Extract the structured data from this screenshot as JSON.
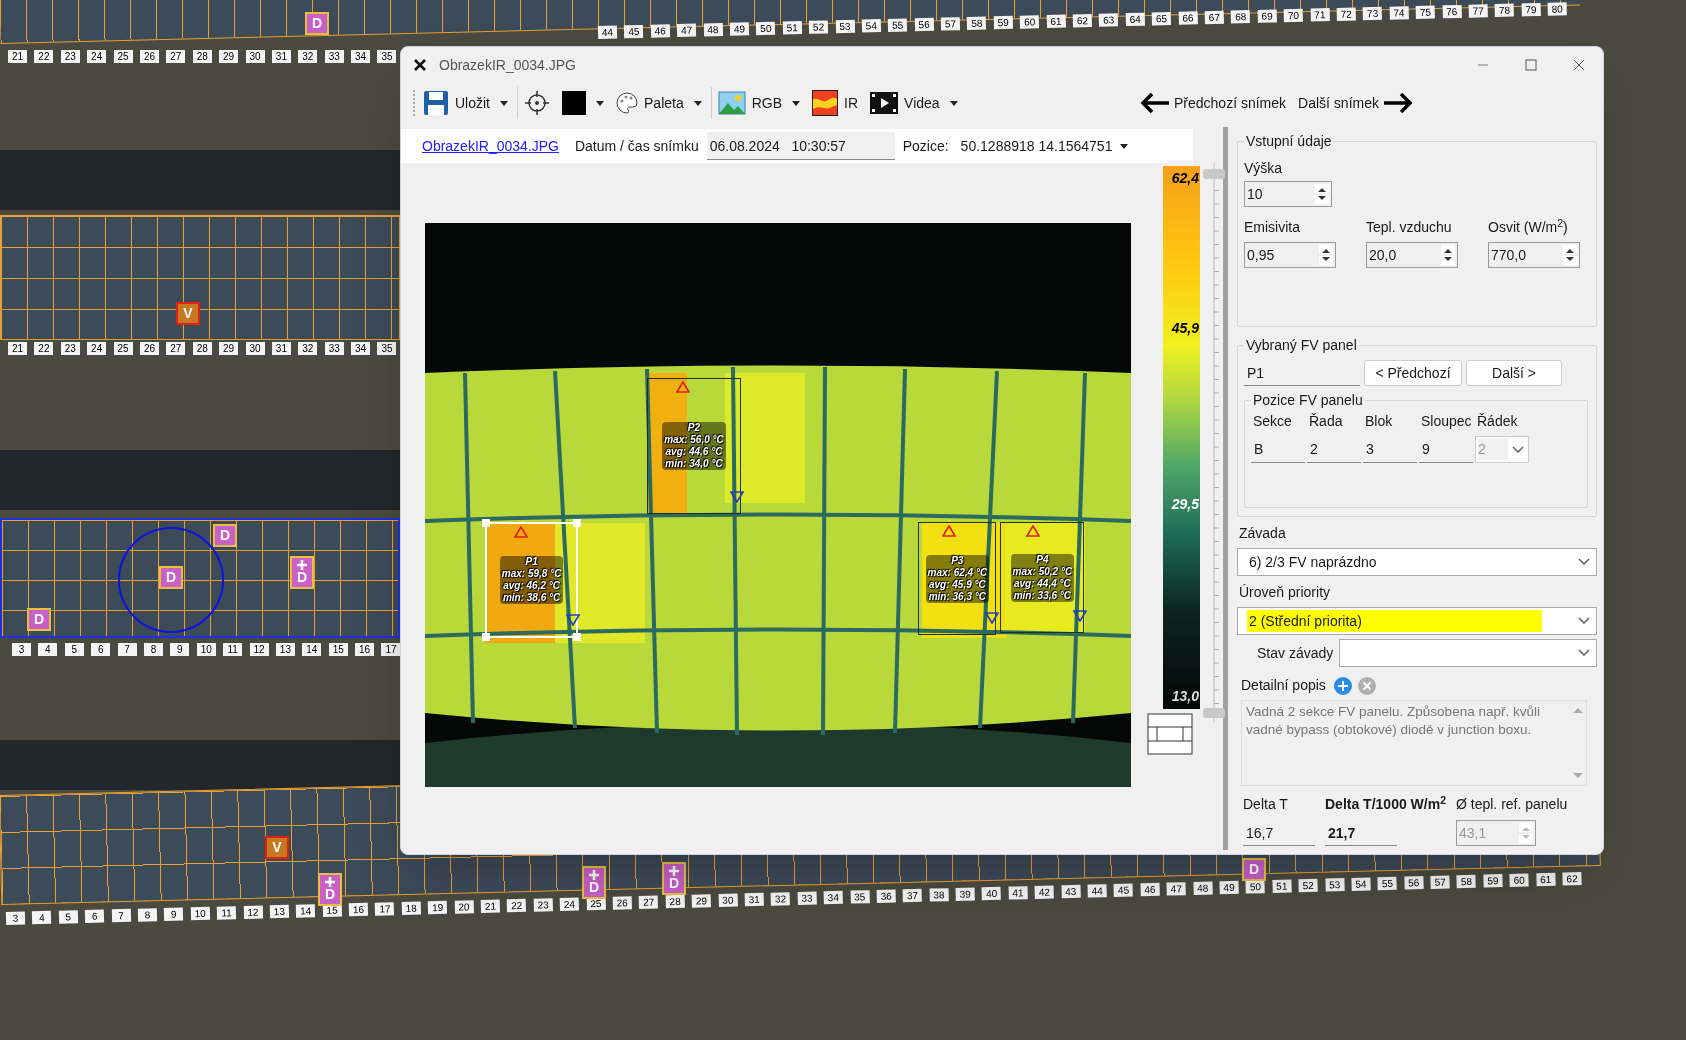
{
  "map": {
    "number_rows": [
      {
        "labels": [
          "21",
          "22",
          "23",
          "24",
          "25",
          "26",
          "27",
          "28",
          "29",
          "30",
          "31",
          "32",
          "33",
          "34",
          "35"
        ]
      },
      {
        "labels": [
          "44",
          "45",
          "46",
          "47",
          "48",
          "49",
          "50",
          "51",
          "52",
          "53",
          "54",
          "55",
          "56",
          "57",
          "58",
          "59",
          "60",
          "61",
          "62",
          "63",
          "64",
          "65",
          "66",
          "67",
          "68",
          "69",
          "70",
          "71",
          "72",
          "73",
          "74",
          "75",
          "76",
          "77",
          "78",
          "79",
          "80"
        ]
      },
      {
        "labels": [
          "21",
          "22",
          "23",
          "24",
          "25",
          "26",
          "27",
          "28",
          "29",
          "30",
          "31",
          "32",
          "33",
          "34",
          "35"
        ]
      },
      {
        "labels": [
          "3",
          "4",
          "5",
          "6",
          "7",
          "8",
          "9",
          "10",
          "11",
          "12",
          "13",
          "14",
          "15",
          "16",
          "17"
        ]
      },
      {
        "labels": [
          "3",
          "4",
          "5",
          "6",
          "7",
          "8",
          "9",
          "10",
          "11",
          "12",
          "13",
          "14",
          "15",
          "16",
          "17",
          "18",
          "19",
          "20",
          "21",
          "22",
          "23",
          "24",
          "25",
          "26",
          "27",
          "28",
          "29",
          "30",
          "31",
          "32",
          "33",
          "34",
          "35",
          "36",
          "37",
          "38",
          "39",
          "40",
          "41",
          "42",
          "43",
          "44",
          "45",
          "46",
          "47",
          "48",
          "49",
          "50",
          "51",
          "52",
          "53",
          "54",
          "55",
          "56",
          "57",
          "58",
          "59",
          "60",
          "61",
          "62"
        ]
      }
    ],
    "markers": [
      {
        "label": "D",
        "kind": "d",
        "plus": false
      },
      {
        "label": "V",
        "kind": "v",
        "plus": false
      },
      {
        "label": "D",
        "kind": "d",
        "plus": false
      },
      {
        "label": "D",
        "kind": "d",
        "plus": false
      },
      {
        "label": "D",
        "kind": "d",
        "plus": true
      },
      {
        "label": "D",
        "kind": "d",
        "plus": false
      },
      {
        "label": "V",
        "kind": "v",
        "plus": false
      },
      {
        "label": "D",
        "kind": "d",
        "plus": true
      },
      {
        "label": "D",
        "kind": "d",
        "plus": true
      },
      {
        "label": "D",
        "kind": "d",
        "plus": true
      },
      {
        "label": "D",
        "kind": "d",
        "plus": false
      }
    ]
  },
  "window": {
    "title": "ObrazekIR_0034.JPG"
  },
  "toolbar": {
    "items": [
      {
        "kind": "save",
        "label": "Uložit",
        "dropdown": true
      },
      {
        "kind": "target",
        "dropdown": false
      },
      {
        "kind": "color",
        "dropdown": true
      },
      {
        "kind": "palette",
        "label": "Paleta",
        "dropdown": true
      },
      {
        "kind": "rgb",
        "label": "RGB",
        "dropdown": true
      },
      {
        "kind": "ir",
        "label": "IR",
        "dropdown": false
      },
      {
        "kind": "video",
        "label": "Videa",
        "dropdown": true
      }
    ],
    "prev": "Předchozí snímek",
    "next": "Další snímek"
  },
  "info": {
    "file_link": "ObrazekIR_0034.JPG",
    "datetime_label": "Datum / čas snímku",
    "datetime_value": "06.08.2024   10:30:57",
    "position_label": "Pozice:",
    "position_value": "50.1288918 14.1564751"
  },
  "scale_labels": [
    "62,4",
    "45,9",
    "29,5",
    "13,0"
  ],
  "annotations": [
    {
      "name": "P1",
      "lines": [
        "max: 59,8 °C",
        "avg: 46,2 °C",
        "min: 38,6 °C"
      ],
      "selected": true
    },
    {
      "name": "P2",
      "lines": [
        "max: 56,0 °C",
        "avg: 44,6 °C",
        "min: 34,0 °C"
      ],
      "selected": false
    },
    {
      "name": "P3",
      "lines": [
        "max: 62,4 °C",
        "avg: 45,9 °C",
        "min: 36,3 °C"
      ],
      "selected": false
    },
    {
      "name": "P4",
      "lines": [
        "max: 50,2 °C",
        "avg: 44,4 °C",
        "min: 33,6 °C"
      ],
      "selected": false
    }
  ],
  "inputs": {
    "title": "Vstupní údaje",
    "height": {
      "label": "Výška",
      "value": "10"
    },
    "fields": [
      {
        "label": "Emisivita",
        "value": "0,95"
      },
      {
        "label": "Tepl. vzduchu",
        "value": "20,0"
      },
      {
        "label": "Osvit (W/m$^{2}$)",
        "value": "770,0"
      }
    ]
  },
  "panel": {
    "title": "Vybraný FV panel",
    "value": "P1",
    "prev_button": "< Předchozí",
    "next_button": "Další >",
    "position": {
      "title": "Pozice FV panelu",
      "columns": [
        {
          "label": "Sekce",
          "value": "B",
          "kind": "text"
        },
        {
          "label": "Řada",
          "value": "2",
          "kind": "text"
        },
        {
          "label": "Blok",
          "value": "3",
          "kind": "text"
        },
        {
          "label": "Sloupec",
          "value": "9",
          "kind": "text"
        },
        {
          "label": "Řádek",
          "value": "2",
          "kind": "combo"
        }
      ]
    }
  },
  "defect": {
    "label": "Závada",
    "value": "6) 2/3 FV naprázdno"
  },
  "priority": {
    "label": "Úroveň priority",
    "value": "2 (Střední priorita)",
    "color": "#ffff00"
  },
  "state": {
    "label": "Stav závady"
  },
  "detail": {
    "label": "Detailní popis",
    "text": "Vadná 2 sekce FV panelu. Způsobena např. kvůli vadné bypass (obtokové) diodě v junction boxu."
  },
  "deltas": [
    {
      "label": "Delta T",
      "value": "16,7",
      "kind": "text"
    },
    {
      "label": "Delta T/1000 W/m$^{2}$",
      "value": "21,7",
      "kind": "bold"
    },
    {
      "label": "Ø tepl. ref. panelu",
      "value": "43,1",
      "kind": "spin",
      "disabled": true
    }
  ]
}
